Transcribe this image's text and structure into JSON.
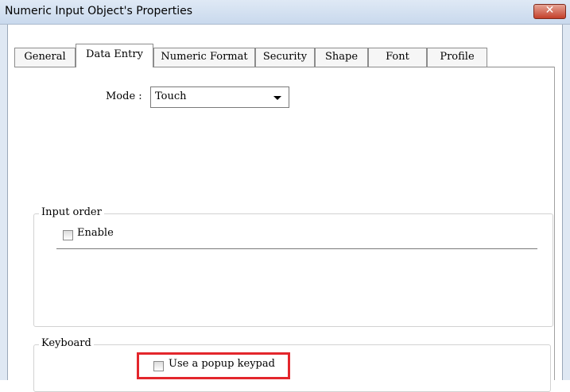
{
  "window": {
    "title": "Numeric Input Object's Properties",
    "close_label": "✕"
  },
  "tabs": [
    {
      "label": "General",
      "active": false
    },
    {
      "label": "Data Entry",
      "active": true
    },
    {
      "label": "Numeric Format",
      "active": false
    },
    {
      "label": "Security",
      "active": false
    },
    {
      "label": "Shape",
      "active": false
    },
    {
      "label": "Font",
      "active": false
    },
    {
      "label": "Profile",
      "active": false
    }
  ],
  "mode": {
    "label": "Mode :",
    "value": "Touch"
  },
  "input_order": {
    "legend": "Input order",
    "enable_label": "Enable",
    "enable_checked": false
  },
  "keyboard": {
    "legend": "Keyboard",
    "popup_label": "Use a popup keypad",
    "popup_checked": false
  },
  "colors": {
    "highlight": "#e3262c",
    "titlebar": "#dfe9f5",
    "close": "#c4402a"
  }
}
